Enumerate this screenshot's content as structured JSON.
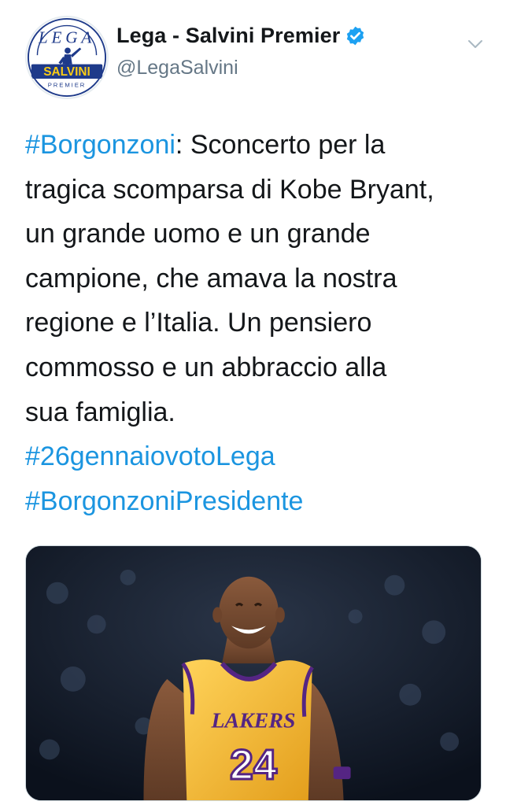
{
  "tweet": {
    "display_name": "Lega - Salvini Premier",
    "handle": "@LegaSalvini",
    "verified_icon": "verified-badge-icon",
    "menu_icon": "chevron-down-icon",
    "avatar": {
      "logo_top_text": "LEGA",
      "logo_ribbon_text": "SALVINI",
      "logo_sub_text": "PREMIER"
    },
    "body": {
      "hashtag_1": "#Borgonzoni",
      "line_1_rest": ": Sconcerto per la",
      "line_2": "tragica scomparsa di Kobe Bryant,",
      "line_3": "un grande uomo e un grande",
      "line_4": "campione, che amava la nostra",
      "line_5": "regione e l’Italia. Un pensiero",
      "line_6": "commosso e un abbraccio alla",
      "line_7": "sua famiglia.",
      "hashtag_2": "#26gennaiovotoLega",
      "hashtag_3": "#BorgonzoniPresidente"
    },
    "media": {
      "jersey_text": "LAKERS",
      "jersey_number": "24"
    },
    "colors": {
      "link": "#1b95e0",
      "verified": "#1da1f2",
      "secondary_text": "#657786",
      "jersey_gold": "#f5b531",
      "jersey_purple": "#552583"
    }
  }
}
